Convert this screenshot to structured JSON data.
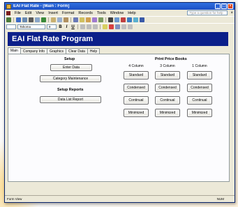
{
  "window": {
    "title": "EAI Flat Rate - [Main : Form]",
    "minimize_glyph": "_",
    "maximize_glyph": "□",
    "close_glyph": "×"
  },
  "menubar": {
    "items": [
      "File",
      "Edit",
      "View",
      "Insert",
      "Format",
      "Records",
      "Tools",
      "Window",
      "Help"
    ],
    "help_placeholder": "Type a question for help",
    "close_glyph": "×"
  },
  "toolbar": {
    "font_name": "Tahoma",
    "font_size": "8",
    "bold": "B",
    "italic": "I",
    "underline": "U"
  },
  "form": {
    "title": "EAI Flat Rate Program",
    "tabs": [
      "Main",
      "Company Info",
      "Graphics",
      "Clear Data",
      "Help"
    ],
    "setup": {
      "label": "Setup",
      "enter_data": "Enter Data",
      "category_maintenance": "Category Maintenance"
    },
    "setup_reports": {
      "label": "Setup Reports",
      "data_list_report": "Data List Report"
    },
    "print_price_books": {
      "label": "Print Price Books",
      "columns": [
        "4 Column",
        "3 Column",
        "1 Column"
      ],
      "rows": [
        "Standard",
        "Condensed",
        "Continual",
        "Minimized"
      ]
    }
  },
  "statusbar": {
    "left": "Form View",
    "right": "NUM"
  },
  "colors": {
    "header_band": "#0b1f8a",
    "titlebar": "#1c4fc4"
  }
}
